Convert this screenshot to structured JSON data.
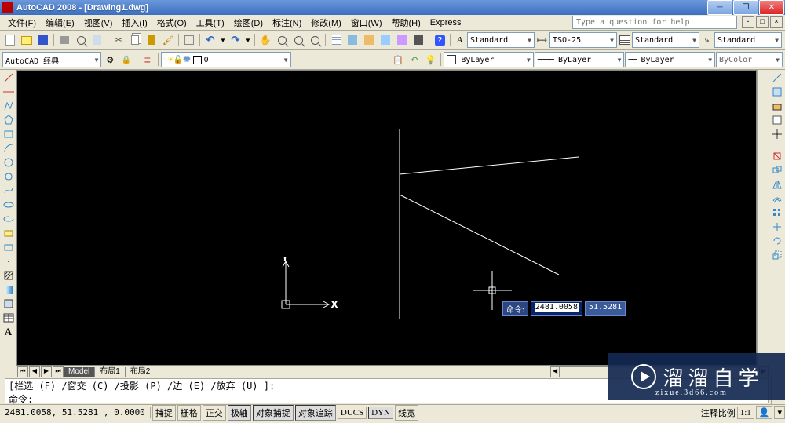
{
  "window": {
    "title": "AutoCAD 2008 - [Drawing1.dwg]",
    "help_placeholder": "Type a question for help"
  },
  "menu": {
    "file": "文件(F)",
    "edit": "编辑(E)",
    "view": "视图(V)",
    "insert": "插入(I)",
    "format": "格式(O)",
    "tools": "工具(T)",
    "draw": "绘图(D)",
    "dimension": "标注(N)",
    "modify": "修改(M)",
    "window": "窗口(W)",
    "help": "帮助(H)",
    "express": "Express"
  },
  "dropdowns": {
    "text_style": "Standard",
    "dim_style": "ISO-25",
    "table_style": "Standard",
    "mleader_style": "Standard",
    "workspace": "AutoCAD 经典",
    "layer": "0",
    "color": "ByLayer",
    "linetype": "ByLayer",
    "lineweight": "ByLayer",
    "plotstyle": "ByColor"
  },
  "tabs": {
    "model": "Model",
    "layout1": "布局1",
    "layout2": "布局2"
  },
  "ucs": {
    "x_label": "X",
    "y_label": "Y"
  },
  "dynamic_input": {
    "prompt": "命令:",
    "value1": "2481.0058",
    "value2": "51.5281"
  },
  "command": {
    "history": "[栏选 (F) /窗交 (C) /投影 (P) /边 (E) /放弃 (U) ]:",
    "prompt": "命令:"
  },
  "status": {
    "coords": "2481.0058, 51.5281 , 0.0000",
    "snap": "捕捉",
    "grid": "栅格",
    "ortho": "正交",
    "polar": "极轴",
    "osnap": "对象捕捉",
    "otrack": "对象追踪",
    "ducs": "DUCS",
    "dyn": "DYN",
    "lwt": "线宽",
    "scale_label": "注释比例",
    "scale_value": "1:1"
  },
  "watermark": {
    "text": "溜溜自学",
    "url": "zixue.3d66.com"
  },
  "icons": {
    "line": "line",
    "pline": "polyline",
    "polygon": "polygon",
    "rect": "rectangle",
    "arc": "arc",
    "circle": "circle",
    "spline": "spline",
    "ellipse": "ellipse",
    "ellipse_arc": "ellipse-arc",
    "block": "insert-block",
    "make_block": "make-block",
    "point": "point",
    "hatch": "hatch",
    "region": "region",
    "table": "table",
    "text": "mtext",
    "dist": "distance",
    "area": "area",
    "qsel": "quick-select",
    "calc": "quickcalc"
  },
  "colors": {
    "canvas_bg": "#000000",
    "drawing": "#ffffff",
    "dyn_input_bg": "#2b4680",
    "highlight": "#0a246a"
  }
}
